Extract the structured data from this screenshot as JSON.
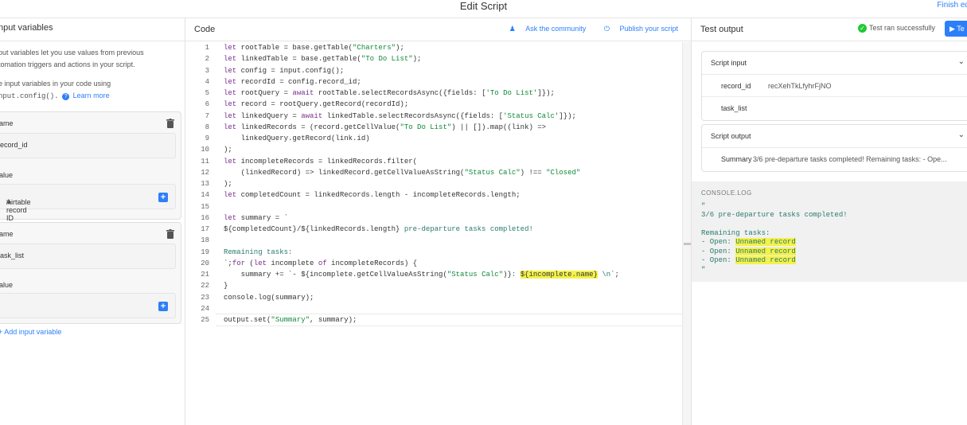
{
  "app": {
    "title": "Edit Script",
    "finish_label": "Finish edit"
  },
  "left": {
    "header": "nput variables",
    "desc1": "put variables let you use values from previous",
    "desc2": "tomation triggers and actions in your script.",
    "desc3": "e input variables in your code using",
    "desc4_code": "nput.config().",
    "learn_more": "Learn more",
    "var1": {
      "name_label": "ame",
      "name_value": "ecord_id",
      "value_label": "alue",
      "value_pill": "Airtable record ID"
    },
    "var2": {
      "name_label": "ame",
      "name_value": "ask_list",
      "value_label": "alue"
    },
    "add_variable": "Add input variable"
  },
  "code": {
    "header": "Code",
    "ask_community": "Ask the community",
    "publish": "Publish your script",
    "line_numbers": [
      "1",
      "2",
      "3",
      "4",
      "5",
      "6",
      "7",
      "8",
      "9",
      "10",
      "11",
      "12",
      "13",
      "14",
      "15",
      "16",
      "17",
      "18",
      "19",
      "20",
      "21",
      "22",
      "23",
      "24",
      "25"
    ]
  },
  "test": {
    "header": "Test output",
    "status": "Test ran successfully",
    "run_label": "Te",
    "script_input": "Script input",
    "inputs": [
      {
        "key": "record_id",
        "value": "recXehTkLfyhrFjNO"
      },
      {
        "key": "task_list",
        "value": ""
      }
    ],
    "script_output": "Script output",
    "output_key": "Summary",
    "output_value": "3/6 pre-departure tasks completed! Remaining tasks: - Ope...",
    "console_title": "CONSOLE.LOG",
    "console": {
      "q1": "\"",
      "l1": "3/6 pre-departure tasks completed!",
      "l2": "Remaining tasks:",
      "prefix": "- Open: ",
      "unnamed": "Unnamed record",
      "q2": "\""
    }
  },
  "colors": {
    "accent": "#2d7ff9",
    "success": "#20c933",
    "highlight": "#f4f14a"
  }
}
